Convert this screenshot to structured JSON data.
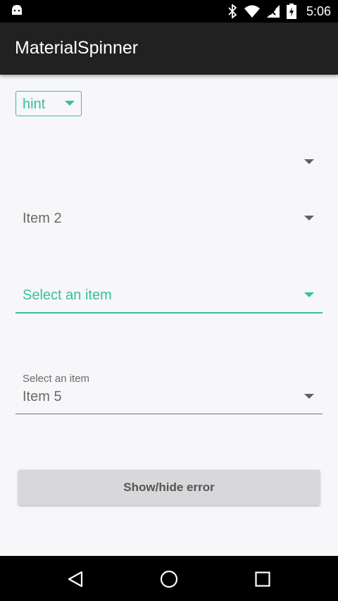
{
  "status_bar": {
    "time": "5:06",
    "icons": [
      "android-icon",
      "bluetooth-icon",
      "wifi-icon",
      "signal-icon",
      "battery-icon"
    ]
  },
  "app_bar": {
    "title": "MaterialSpinner"
  },
  "spinners": {
    "hint": {
      "label": "hint"
    },
    "empty": {
      "value": ""
    },
    "item2": {
      "value": "Item 2"
    },
    "select": {
      "placeholder": "Select an item"
    },
    "floating": {
      "label": "Select an item",
      "value": "Item 5"
    }
  },
  "button": {
    "label": "Show/hide error"
  },
  "navigation": {
    "icons": [
      "back-icon",
      "home-icon",
      "recents-icon"
    ]
  },
  "colors": {
    "accent": "#33c29d",
    "text": "#6a6a6a",
    "appbar": "#212121"
  }
}
